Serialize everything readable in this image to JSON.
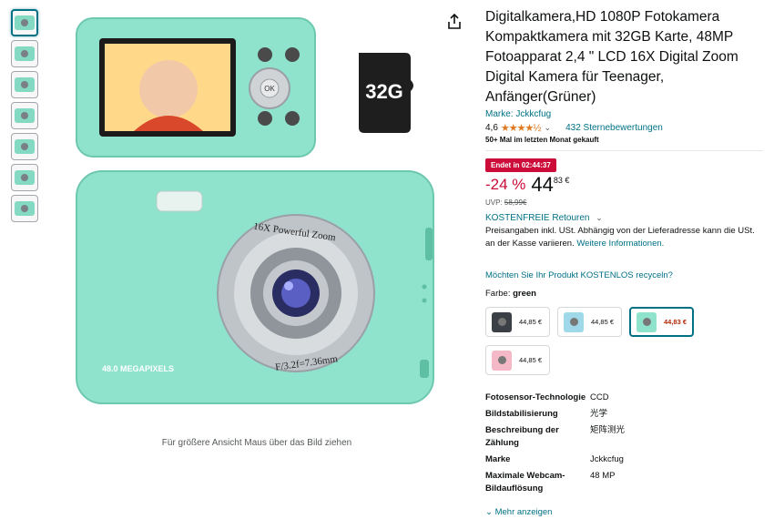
{
  "thumbnails": [
    {
      "label": "",
      "color": "#83d9c1"
    },
    {
      "label": "",
      "color": "#83d9c1"
    },
    {
      "label": "",
      "color": "#83d9c1"
    },
    {
      "label": "",
      "color": "#83d9c1"
    },
    {
      "label": "",
      "color": "#83d9c1"
    },
    {
      "label": "",
      "color": "#83d9c1"
    },
    {
      "label": "",
      "color": "#83d9c1"
    }
  ],
  "hero": {
    "zoom_text": "16X Powerful Zoom",
    "megapixels_text": "48.0 MEGAPIXELS",
    "lens_text": "F/3.2f=7.36mm",
    "sd_card_text": "32G",
    "ok_text": "OK",
    "body_color": "#8fe3cc"
  },
  "hover_hint": "Für größere Ansicht Maus über das Bild ziehen",
  "product": {
    "title": "Digitalkamera,HD 1080P Fotokamera Kompaktkamera mit 32GB Karte, 48MP Fotoapparat 2,4 \" LCD 16X Digital Zoom Digital Kamera für Teenager, Anfänger(Grüner)",
    "brand_link": "Marke: Jckkcfug",
    "rating_value": "4,6",
    "stars": "★★★★½",
    "rating_count": "432 Sternebewertungen",
    "bought": "50+ Mal im letzten Monat gekauft",
    "deal_badge": "Endet in 02:44:37",
    "discount": "-24 %",
    "price_whole": "44",
    "price_fraction": "83 €",
    "uvp_label": "UVP:",
    "uvp_value": "58,99€",
    "free_returns": "KOSTENFREIE Retouren",
    "tax_text": "Preisangaben inkl. USt. Abhängig von der Lieferadresse kann die USt. an der Kasse variieren.",
    "tax_link": "Weitere Informationen.",
    "recycle": "Möchten Sie Ihr Produkt KOSTENLOS recyceln?",
    "color_label": "Farbe:",
    "color_value": "green"
  },
  "swatches": [
    {
      "price": "44,85 €",
      "color": "#3b3f46",
      "selected": false
    },
    {
      "price": "44,85 €",
      "color": "#9fd8e8",
      "selected": false
    },
    {
      "price": "44,83 €",
      "color": "#8fe3cc",
      "selected": true
    },
    {
      "price": "44,85 €",
      "color": "#f4b8c6",
      "selected": false
    }
  ],
  "specs": [
    {
      "key": "Fotosensor-Technologie",
      "value": "CCD"
    },
    {
      "key": "Bildstabilisierung",
      "value": "光学"
    },
    {
      "key": "Beschreibung der Zählung",
      "value": "矩阵测光"
    },
    {
      "key": "Marke",
      "value": "Jckkcfug"
    },
    {
      "key": "Maximale Webcam-Bildauflösung",
      "value": "48 MP"
    }
  ],
  "show_more": "Mehr anzeigen"
}
